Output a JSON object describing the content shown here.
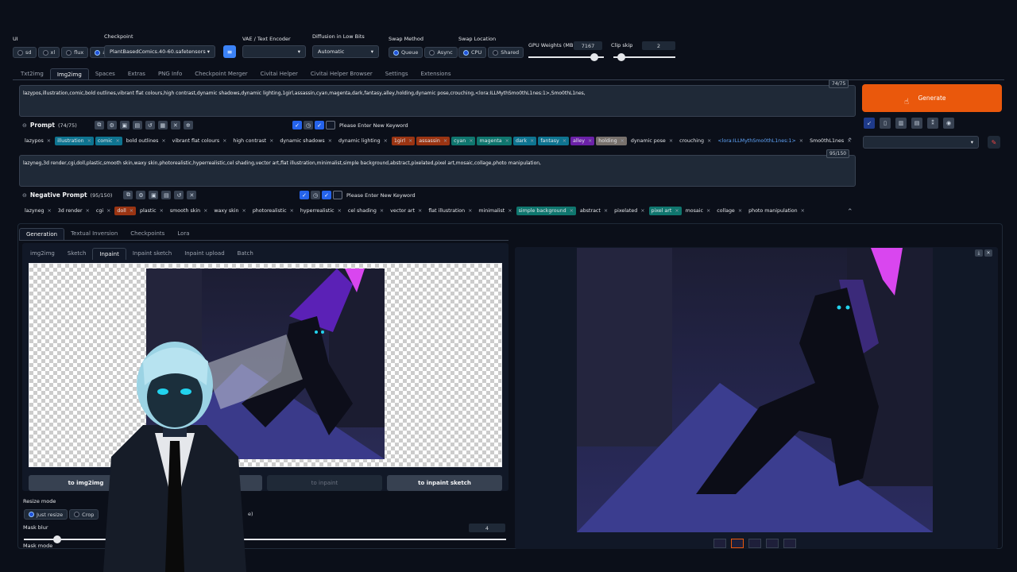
{
  "top": {
    "ui_label": "UI",
    "ui_options": [
      "sd",
      "xl",
      "flux",
      "all"
    ],
    "ui_selected": "all",
    "checkpoint_label": "Checkpoint",
    "checkpoint_value": "PlantBasedComics.40-60.safetensors",
    "vae_label": "VAE / Text Encoder",
    "vae_value": "",
    "diffusion_label": "Diffusion in Low Bits",
    "diffusion_value": "Automatic",
    "swap_method_label": "Swap Method",
    "swap_method_options": [
      "Queue",
      "Async"
    ],
    "swap_location_label": "Swap Location",
    "swap_location_options": [
      "CPU",
      "Shared"
    ],
    "gpu_weights_label": "GPU Weights (MB)",
    "gpu_weights_value": "7167",
    "clip_skip_label": "Clip skip",
    "clip_skip_value": "2"
  },
  "main_tabs": [
    "Txt2img",
    "Img2img",
    "Spaces",
    "Extras",
    "PNG Info",
    "Checkpoint Merger",
    "Civitai Helper",
    "Civitai Helper Browser",
    "Settings",
    "Extensions"
  ],
  "main_tab_active": "Img2img",
  "prompt": {
    "text": "lazypos,illustration,comic,bold outlines,vibrant flat colours,high contrast,dynamic shadows,dynamic lighting,1girl,assassin,cyan,magenta,dark,fantasy,alley,holding,dynamic pose,crouching,<lora:ILLMythSmo0thL1nes:1>,Smo0thL1nes,",
    "counter": "74/75",
    "label": "Prompt",
    "count": "(74/75)",
    "keyword_placeholder": "Please Enter New Keyword",
    "tags": [
      {
        "t": "lazypos",
        "c": ""
      },
      {
        "t": "illustration",
        "c": "#0e7490"
      },
      {
        "t": "comic",
        "c": "#0e7490"
      },
      {
        "t": "bold outlines",
        "c": ""
      },
      {
        "t": "vibrant flat colours",
        "c": ""
      },
      {
        "t": "high contrast",
        "c": ""
      },
      {
        "t": "dynamic shadows",
        "c": ""
      },
      {
        "t": "dynamic lighting",
        "c": ""
      },
      {
        "t": "1girl",
        "c": "#9a3412"
      },
      {
        "t": "assassin",
        "c": "#9a3412"
      },
      {
        "t": "cyan",
        "c": "#0f766e"
      },
      {
        "t": "magenta",
        "c": "#0f766e"
      },
      {
        "t": "dark",
        "c": "#0e7490"
      },
      {
        "t": "fantasy",
        "c": "#0e7490"
      },
      {
        "t": "alley",
        "c": "#6b21a8"
      },
      {
        "t": "holding",
        "c": "#78716c"
      },
      {
        "t": "dynamic pose",
        "c": ""
      },
      {
        "t": "crouching",
        "c": ""
      },
      {
        "t": "<lora:ILLMythSmo0thL1nes:1>",
        "c": "lora"
      },
      {
        "t": "Smo0thL1nes",
        "c": ""
      }
    ]
  },
  "negative": {
    "text": "lazyneg,3d render,cgi,doll,plastic,smooth skin,waxy skin,photorealistic,hyperrealistic,cel shading,vector art,flat illustration,minimalist,simple background,abstract,pixelated,pixel art,mosaic,collage,photo manipulation,",
    "counter": "95/150",
    "label": "Negative Prompt",
    "count": "(95/150)",
    "keyword_placeholder": "Please Enter New Keyword",
    "tags": [
      {
        "t": "lazyneg",
        "c": ""
      },
      {
        "t": "3d render",
        "c": ""
      },
      {
        "t": "cgi",
        "c": ""
      },
      {
        "t": "doll",
        "c": "#9a3412"
      },
      {
        "t": "plastic",
        "c": ""
      },
      {
        "t": "smooth skin",
        "c": ""
      },
      {
        "t": "waxy skin",
        "c": ""
      },
      {
        "t": "photorealistic",
        "c": ""
      },
      {
        "t": "hyperrealistic",
        "c": ""
      },
      {
        "t": "cel shading",
        "c": ""
      },
      {
        "t": "vector art",
        "c": ""
      },
      {
        "t": "flat illustration",
        "c": ""
      },
      {
        "t": "minimalist",
        "c": ""
      },
      {
        "t": "simple background",
        "c": "#0f766e"
      },
      {
        "t": "abstract",
        "c": ""
      },
      {
        "t": "pixelated",
        "c": ""
      },
      {
        "t": "pixel art",
        "c": "#0f766e"
      },
      {
        "t": "mosaic",
        "c": ""
      },
      {
        "t": "collage",
        "c": ""
      },
      {
        "t": "photo manipulation",
        "c": ""
      }
    ]
  },
  "generate_label": "Generate",
  "sub_tabs": [
    "Generation",
    "Textual Inversion",
    "Checkpoints",
    "Lora"
  ],
  "sub_tab_active": "Generation",
  "img_tabs": [
    "img2img",
    "Sketch",
    "Inpaint",
    "Inpaint sketch",
    "Inpaint upload",
    "Batch"
  ],
  "img_tab_active": "Inpaint",
  "copy_buttons": [
    "to img2img",
    "",
    "to inpaint",
    "to inpaint sketch"
  ],
  "resize_mode_label": "Resize mode",
  "resize_options": [
    "Just resize",
    "Crop"
  ],
  "resize_extra": "e)",
  "mask_blur_label": "Mask blur",
  "mask_blur_value": "4",
  "mask_mode_label": "Mask mode",
  "colors": {
    "accent": "#ea580c",
    "bg": "#0b0f19",
    "panel": "#1f2937"
  }
}
